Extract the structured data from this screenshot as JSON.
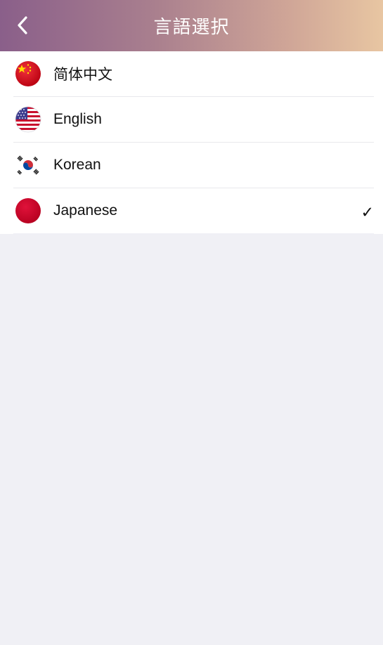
{
  "header": {
    "title": "言語選択",
    "back_icon": "chevron-left-icon"
  },
  "languages": [
    {
      "label": "简体中文",
      "flag": "china-flag-icon",
      "selected": false
    },
    {
      "label": "English",
      "flag": "usa-flag-icon",
      "selected": false
    },
    {
      "label": "Korean",
      "flag": "korea-flag-icon",
      "selected": false
    },
    {
      "label": "Japanese",
      "flag": "japan-flag-icon",
      "selected": true
    }
  ],
  "check_mark": "✓",
  "colors": {
    "header_gradient_start": "#8a5f8a",
    "header_gradient_end": "#e8c6a2",
    "background": "#f0f0f5"
  }
}
